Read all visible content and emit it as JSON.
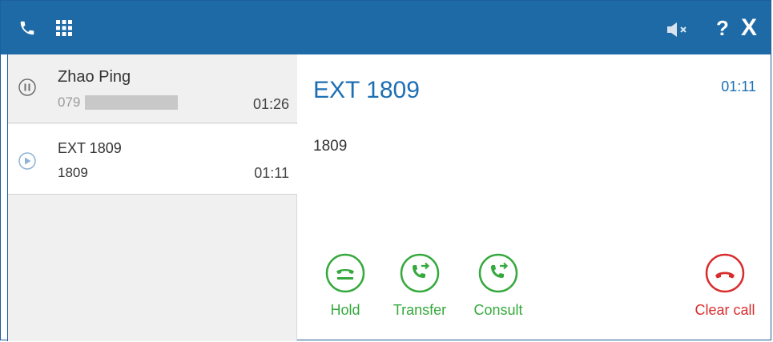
{
  "toolbar": {
    "icons": [
      "phone-icon",
      "dialpad-icon",
      "speaker-mute-icon",
      "help-icon",
      "close-icon"
    ],
    "help_glyph": "?",
    "close_glyph": "X",
    "color": "#1e6aa6"
  },
  "calls": [
    {
      "name": "Zhao Ping",
      "number": "079",
      "duration": "01:26",
      "state": "held",
      "state_icon": "pause-icon"
    },
    {
      "name": "EXT 1809",
      "number": "1809",
      "duration": "01:11",
      "state": "active",
      "state_icon": "play-icon"
    }
  ],
  "detail": {
    "title": "EXT 1809",
    "timer": "01:11",
    "number": "1809"
  },
  "actions": {
    "hold": "Hold",
    "transfer": "Transfer",
    "consult": "Consult",
    "clear_call": "Clear call"
  },
  "colors": {
    "accent_blue": "#1d6fb4",
    "action_green": "#35a93d",
    "action_red": "#d92d2d"
  }
}
